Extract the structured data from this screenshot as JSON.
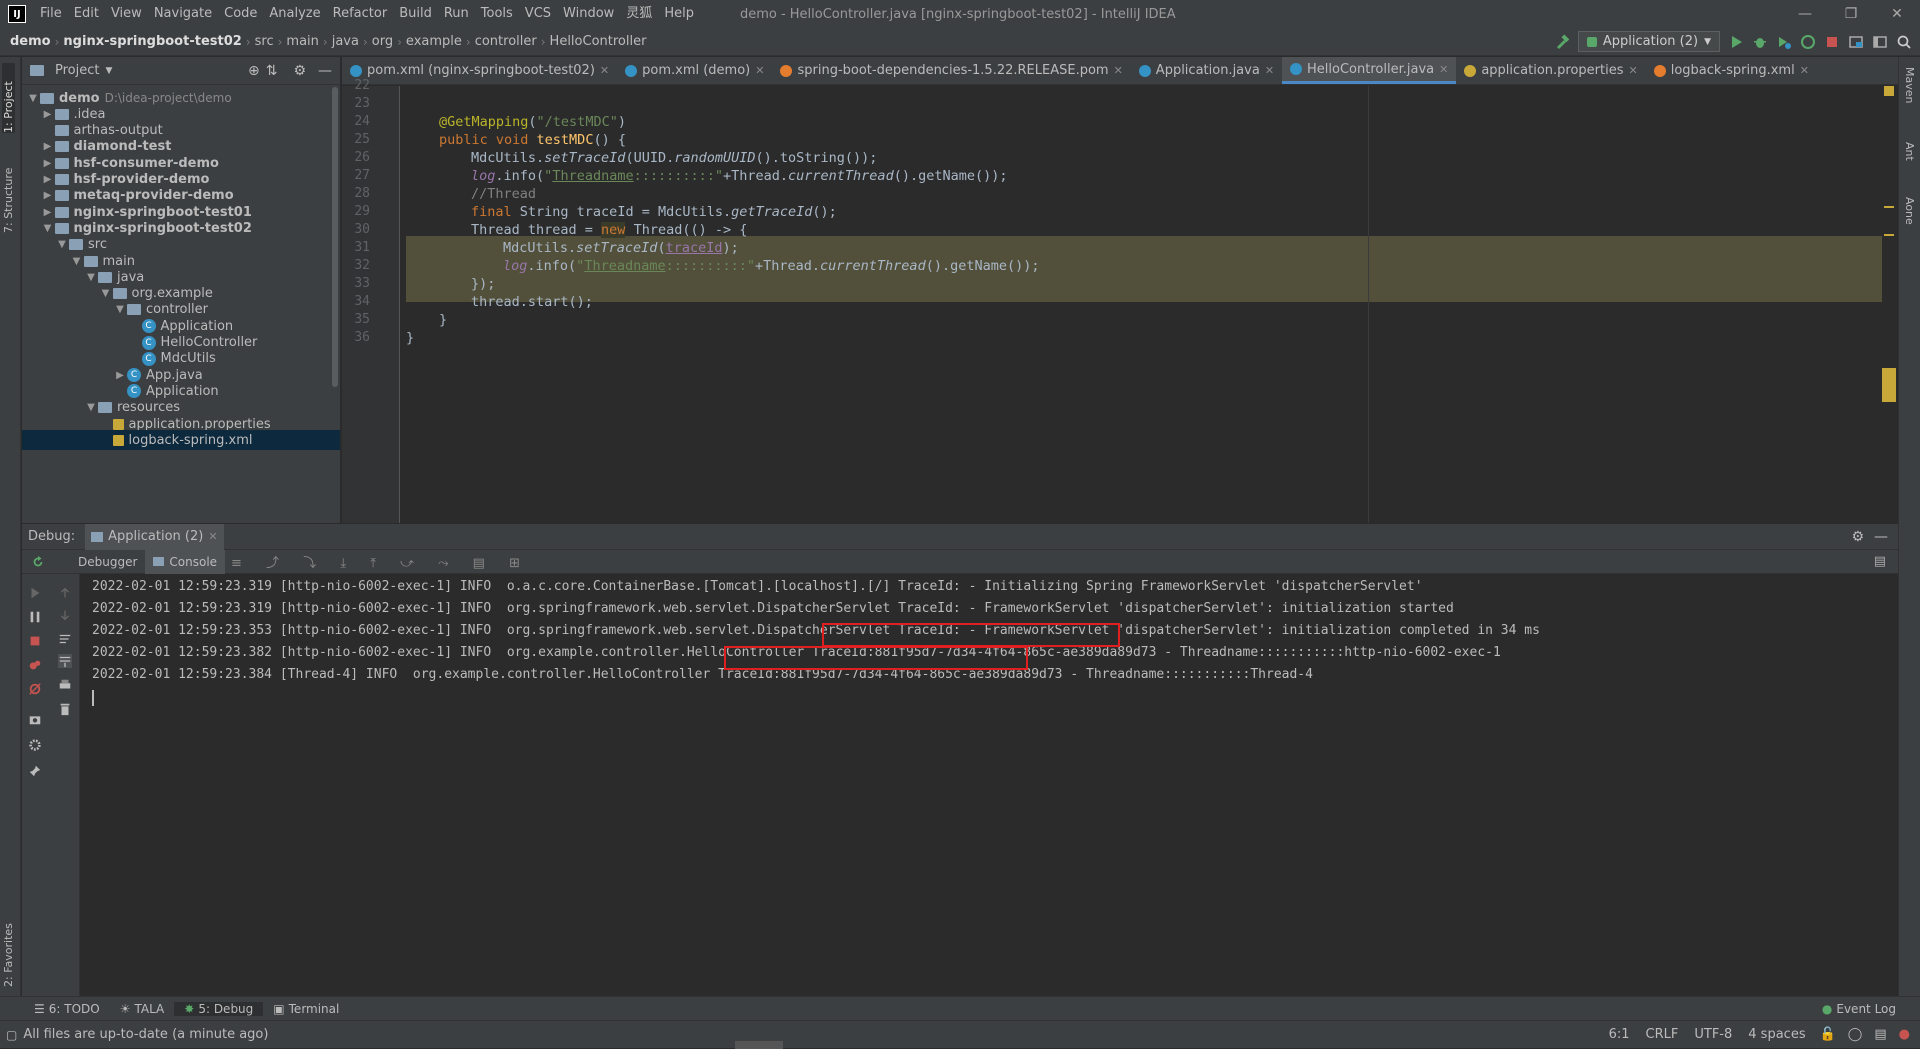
{
  "titlebar": {
    "app_icon": "intellij-icon",
    "menus": [
      "File",
      "Edit",
      "View",
      "Navigate",
      "Code",
      "Analyze",
      "Refactor",
      "Build",
      "Run",
      "Tools",
      "VCS",
      "Window",
      "灵狐",
      "Help"
    ],
    "title": "demo - HelloController.java [nginx-springboot-test02] - IntelliJ IDEA"
  },
  "navbar": {
    "crumbs": [
      "demo",
      "nginx-springboot-test02",
      "src",
      "main",
      "java",
      "org",
      "example",
      "controller",
      "HelloController"
    ],
    "run_config": "Application (2)"
  },
  "left_strip": {
    "project": "1: Project",
    "structure": "7: Structure",
    "favorites": "2: Favorites"
  },
  "right_strip": {
    "maven": "Maven",
    "ant": "Ant",
    "aone": "Aone"
  },
  "project": {
    "header": "Project",
    "tree": [
      {
        "label": "demo",
        "hint": "D:\\idea-project\\demo",
        "depth": 0,
        "type": "folder",
        "expanded": true,
        "bold": true
      },
      {
        "label": ".idea",
        "depth": 1,
        "type": "folder",
        "expanded": false
      },
      {
        "label": "arthas-output",
        "depth": 1,
        "type": "folder"
      },
      {
        "label": "diamond-test",
        "depth": 1,
        "type": "folder",
        "expanded": false,
        "bold": true
      },
      {
        "label": "hsf-consumer-demo",
        "depth": 1,
        "type": "folder",
        "expanded": false,
        "bold": true
      },
      {
        "label": "hsf-provider-demo",
        "depth": 1,
        "type": "folder",
        "expanded": false,
        "bold": true
      },
      {
        "label": "metaq-provider-demo",
        "depth": 1,
        "type": "folder",
        "expanded": false,
        "bold": true
      },
      {
        "label": "nginx-springboot-test01",
        "depth": 1,
        "type": "folder",
        "expanded": false,
        "bold": true
      },
      {
        "label": "nginx-springboot-test02",
        "depth": 1,
        "type": "folder",
        "expanded": true,
        "bold": true
      },
      {
        "label": "src",
        "depth": 2,
        "type": "folder",
        "expanded": true
      },
      {
        "label": "main",
        "depth": 3,
        "type": "folder",
        "expanded": true
      },
      {
        "label": "java",
        "depth": 4,
        "type": "folder",
        "expanded": true
      },
      {
        "label": "org.example",
        "depth": 5,
        "type": "folder",
        "expanded": true
      },
      {
        "label": "controller",
        "depth": 6,
        "type": "folder",
        "expanded": true
      },
      {
        "label": "Application",
        "depth": 7,
        "type": "class"
      },
      {
        "label": "HelloController",
        "depth": 7,
        "type": "class"
      },
      {
        "label": "MdcUtils",
        "depth": 7,
        "type": "class"
      },
      {
        "label": "App.java",
        "depth": 6,
        "type": "class",
        "expanded": false
      },
      {
        "label": "Application",
        "depth": 6,
        "type": "class"
      },
      {
        "label": "resources",
        "depth": 4,
        "type": "folder",
        "expanded": true
      },
      {
        "label": "application.properties",
        "depth": 5,
        "type": "file"
      },
      {
        "label": "logback-spring.xml",
        "depth": 5,
        "type": "file",
        "selected": true
      }
    ]
  },
  "tabs": [
    {
      "label": "pom.xml (nginx-springboot-test02)",
      "icon": "maven-icon"
    },
    {
      "label": "pom.xml (demo)",
      "icon": "maven-icon"
    },
    {
      "label": "spring-boot-dependencies-1.5.22.RELEASE.pom",
      "icon": "xml-icon"
    },
    {
      "label": "Application.java",
      "icon": "class-icon"
    },
    {
      "label": "HelloController.java",
      "icon": "class-icon",
      "active": true
    },
    {
      "label": "application.properties",
      "icon": "properties-icon"
    },
    {
      "label": "logback-spring.xml",
      "icon": "xml-icon"
    }
  ],
  "editor": {
    "line_numbers": [
      "22",
      "23",
      "24",
      "25",
      "26",
      "27",
      "28",
      "29",
      "30",
      "31",
      "32",
      "33",
      "34",
      "35",
      "36"
    ]
  },
  "debug": {
    "label": "Debug:",
    "session": "Application (2)",
    "tabs": [
      "Debugger",
      "Console"
    ],
    "log": [
      "2022-02-01 12:59:23.319 [http-nio-6002-exec-1] INFO  o.a.c.core.ContainerBase.[Tomcat].[localhost].[/] TraceId: - Initializing Spring FrameworkServlet 'dispatcherServlet'",
      "2022-02-01 12:59:23.319 [http-nio-6002-exec-1] INFO  org.springframework.web.servlet.DispatcherServlet TraceId: - FrameworkServlet 'dispatcherServlet': initialization started",
      "2022-02-01 12:59:23.353 [http-nio-6002-exec-1] INFO  org.springframework.web.servlet.DispatcherServlet TraceId: - FrameworkServlet 'dispatcherServlet': initialization completed in 34 ms",
      "2022-02-01 12:59:23.382 [http-nio-6002-exec-1] INFO  org.example.controller.HelloController TraceId:881f95d7-7d34-4f64-865c-ae389da89d73 - Threadname:::::::::::http-nio-6002-exec-1",
      "2022-02-01 12:59:23.384 [Thread-4] INFO  org.example.controller.HelloController TraceId:881f95d7-7d34-4f64-865c-ae389da89d73 - Threadname:::::::::::Thread-4"
    ]
  },
  "bottom_tools": [
    "6: TODO",
    "TALA",
    "5: Debug",
    "Terminal"
  ],
  "event_log": "Event Log",
  "status": {
    "message": "All files are up-to-date (a minute ago)",
    "position": "6:1",
    "line_sep": "CRLF",
    "encoding": "UTF-8",
    "indent": "4 spaces"
  },
  "colors": {
    "background": "#2b2b2b",
    "panel": "#3c3f41",
    "keyword": "#cc7832",
    "string": "#6a8759",
    "annotation": "#bbb529",
    "highlight": "#52503a",
    "accent": "#4a88c7",
    "redbox": "#e02020"
  }
}
